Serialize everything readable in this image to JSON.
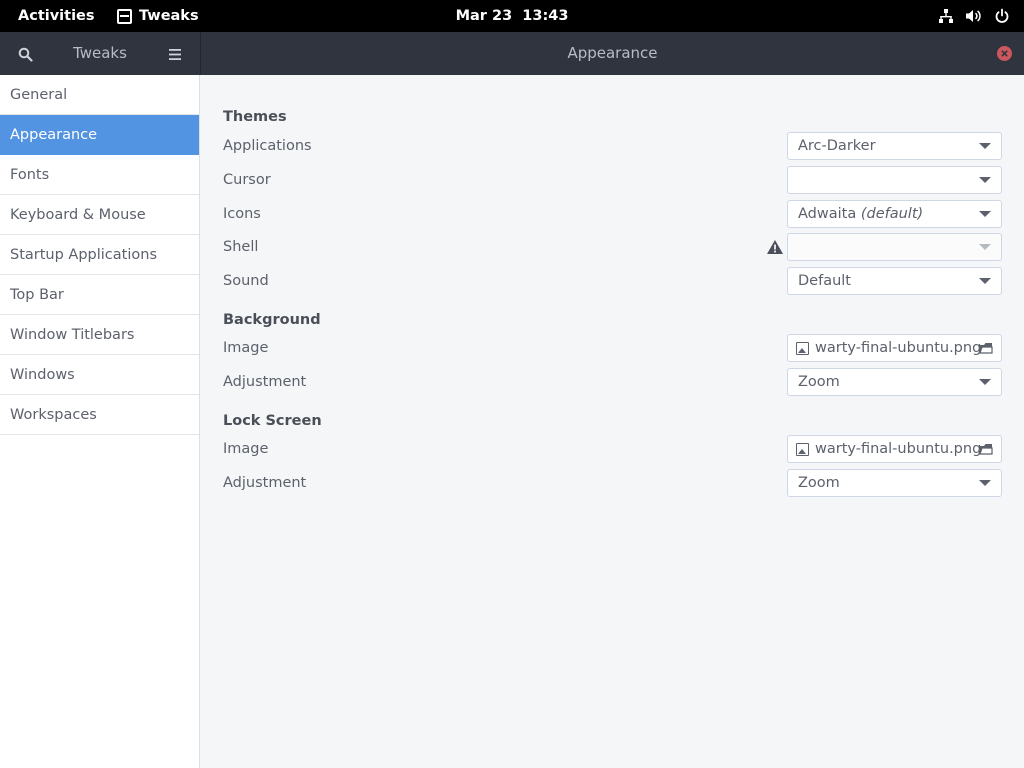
{
  "topbar": {
    "activities": "Activities",
    "app_name": "Tweaks",
    "clock": "Mar 23  13:43",
    "status_icons": [
      "network-icon",
      "volume-icon",
      "power-icon"
    ]
  },
  "headerbar": {
    "left_title": "Tweaks",
    "title": "Appearance"
  },
  "sidebar": {
    "items": [
      {
        "label": "General"
      },
      {
        "label": "Appearance",
        "selected": true
      },
      {
        "label": "Fonts"
      },
      {
        "label": "Keyboard & Mouse"
      },
      {
        "label": "Startup Applications"
      },
      {
        "label": "Top Bar"
      },
      {
        "label": "Window Titlebars"
      },
      {
        "label": "Windows"
      },
      {
        "label": "Workspaces"
      }
    ]
  },
  "main": {
    "themes": {
      "heading": "Themes",
      "applications_label": "Applications",
      "applications_value": "Arc-Darker",
      "cursor_label": "Cursor",
      "cursor_value": "",
      "icons_label": "Icons",
      "icons_value": "Adwaita",
      "icons_suffix": "(default)",
      "shell_label": "Shell",
      "shell_value": "",
      "sound_label": "Sound",
      "sound_value": "Default"
    },
    "background": {
      "heading": "Background",
      "image_label": "Image",
      "image_value": "warty-final-ubuntu.png",
      "adjustment_label": "Adjustment",
      "adjustment_value": "Zoom"
    },
    "lock_screen": {
      "heading": "Lock Screen",
      "image_label": "Image",
      "image_value": "warty-final-ubuntu.png",
      "adjustment_label": "Adjustment",
      "adjustment_value": "Zoom"
    }
  },
  "colors": {
    "accent": "#5294e2",
    "headerbar": "#2f343f",
    "close": "#cc575d"
  }
}
